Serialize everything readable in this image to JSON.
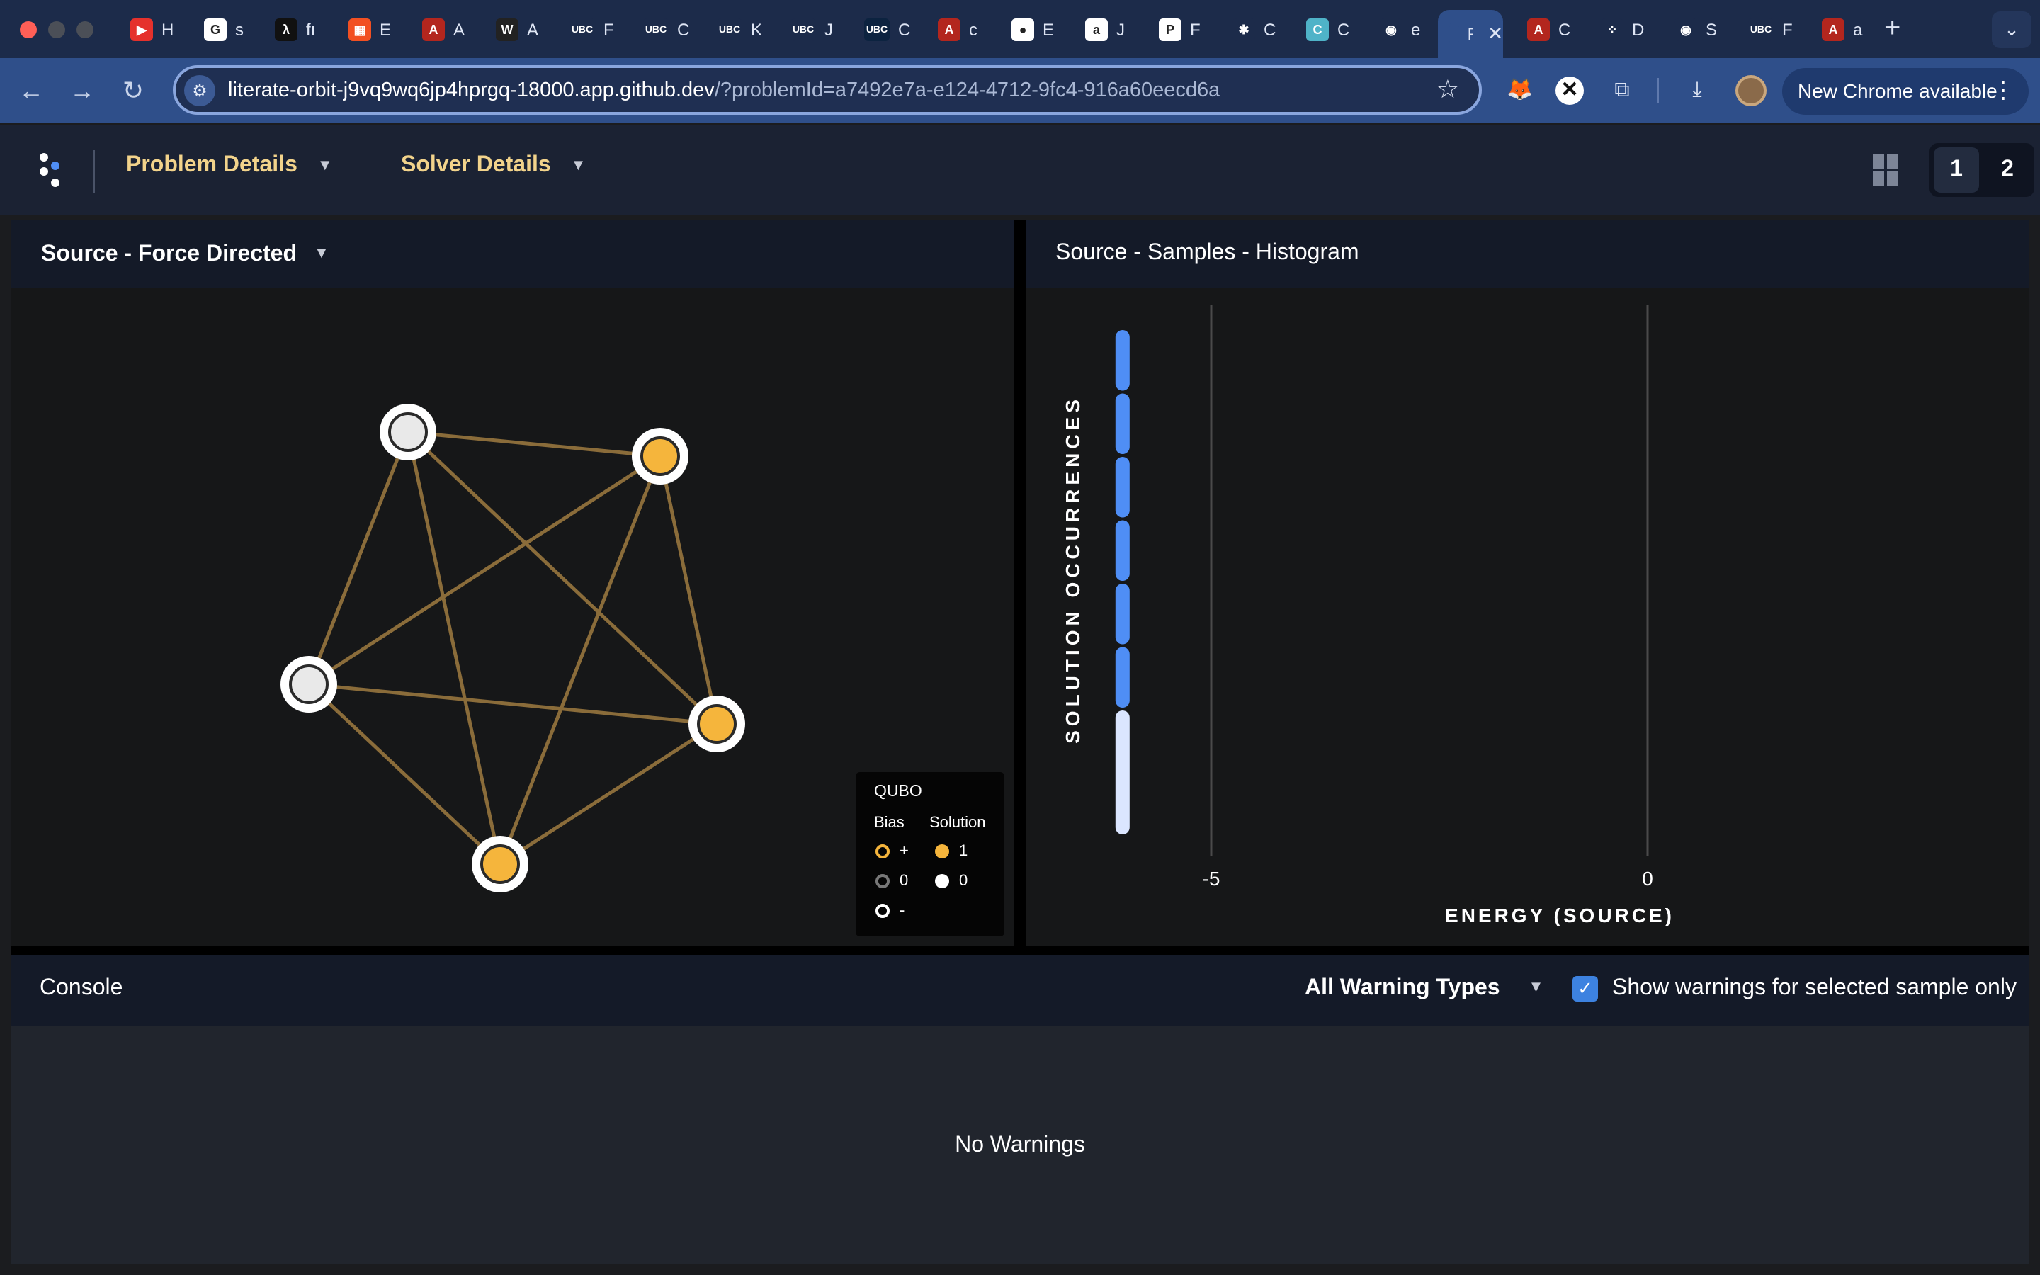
{
  "browser": {
    "tabs": [
      {
        "icon": "youtube-icon",
        "label": "H",
        "color": "#e5312c",
        "glyph": "▶"
      },
      {
        "icon": "google-icon",
        "label": "s",
        "color": "#ffffff",
        "glyph": "G"
      },
      {
        "icon": "lambda-icon",
        "label": "fı",
        "color": "#111111",
        "glyph": "λ"
      },
      {
        "icon": "microsoft-icon",
        "label": "E",
        "color": "#f25022",
        "glyph": "▦"
      },
      {
        "icon": "pdf-icon",
        "label": "A",
        "color": "#b3261e",
        "glyph": "A"
      },
      {
        "icon": "w-icon",
        "label": "A",
        "color": "#222222",
        "glyph": "W"
      },
      {
        "icon": "ubc-icon",
        "label": "F",
        "color": "#1c2b4a",
        "glyph": "UBC"
      },
      {
        "icon": "ubc-icon",
        "label": "C",
        "color": "#1c2b4a",
        "glyph": "UBC"
      },
      {
        "icon": "ubc-icon",
        "label": "K",
        "color": "#1c2b4a",
        "glyph": "UBC"
      },
      {
        "icon": "ubc-icon",
        "label": "J",
        "color": "#1c2b4a",
        "glyph": "UBC"
      },
      {
        "icon": "ubc-icon",
        "label": "C",
        "color": "#0c2340",
        "glyph": "UBC"
      },
      {
        "icon": "pdf-icon",
        "label": "c",
        "color": "#b3261e",
        "glyph": "A"
      },
      {
        "icon": "apple-icon",
        "label": "E",
        "color": "#ffffff",
        "glyph": "●"
      },
      {
        "icon": "amazon-icon",
        "label": "J",
        "color": "#ffffff",
        "glyph": "a"
      },
      {
        "icon": "p-icon",
        "label": "F",
        "color": "#ffffff",
        "glyph": "P"
      },
      {
        "icon": "openai-icon",
        "label": "C",
        "color": "#1c2b4a",
        "glyph": "✱"
      },
      {
        "icon": "c-icon",
        "label": "C",
        "color": "#4fb3c8",
        "glyph": "C"
      },
      {
        "icon": "github-icon",
        "label": "e",
        "color": "#1c2b4a",
        "glyph": "◉"
      },
      {
        "icon": "app-icon",
        "label": "F",
        "color": "#2f4f8a",
        "glyph": "",
        "active": true
      },
      {
        "icon": "pdf-icon",
        "label": "C",
        "color": "#b3261e",
        "glyph": "A"
      },
      {
        "icon": "dots-icon",
        "label": "D",
        "color": "#1c2b4a",
        "glyph": "⁘"
      },
      {
        "icon": "github-icon",
        "label": "S",
        "color": "#1c2b4a",
        "glyph": "◉"
      },
      {
        "icon": "ubc-icon",
        "label": "F",
        "color": "#1c2b4a",
        "glyph": "UBC"
      },
      {
        "icon": "pdf-icon",
        "label": "a",
        "color": "#b3261e",
        "glyph": "A"
      }
    ],
    "url_host": "literate-orbit-j9vq9wq6jp4hprgq-18000.app.github.dev",
    "url_rest": "/?problemId=a7492e7a-e124-4712-9fc4-916a60eecd6a",
    "update_label": "New Chrome available"
  },
  "header": {
    "problem_details": "Problem Details",
    "solver_details": "Solver Details",
    "pages": [
      "1",
      "2"
    ]
  },
  "left_panel": {
    "title": "Source - Force Directed",
    "legend": {
      "title": "QUBO",
      "bias_header": "Bias",
      "solution_header": "Solution",
      "bias_items": [
        "+",
        "0",
        "-"
      ],
      "solution_items": [
        "1",
        "0"
      ]
    },
    "graph": {
      "nodes": [
        {
          "id": "n1",
          "solution": 0
        },
        {
          "id": "n2",
          "solution": 1
        },
        {
          "id": "n3",
          "solution": 0
        },
        {
          "id": "n4",
          "solution": 1
        },
        {
          "id": "n5",
          "solution": 1
        }
      ],
      "edges": [
        [
          "n1",
          "n2"
        ],
        [
          "n1",
          "n3"
        ],
        [
          "n1",
          "n4"
        ],
        [
          "n1",
          "n5"
        ],
        [
          "n2",
          "n3"
        ],
        [
          "n2",
          "n4"
        ],
        [
          "n2",
          "n5"
        ],
        [
          "n3",
          "n4"
        ],
        [
          "n3",
          "n5"
        ],
        [
          "n4",
          "n5"
        ]
      ],
      "colors": {
        "edge": "#8a6c3a",
        "one": "#f5b53c",
        "zero": "#e9e9e9"
      }
    }
  },
  "right_panel": {
    "title": "Source - Samples - Histogram",
    "chart_data": {
      "type": "bar",
      "xlabel": "ENERGY (SOURCE)",
      "ylabel": "SOLUTION OCCURRENCES",
      "x_ticks": [
        -5,
        0
      ],
      "bars": [
        {
          "energy": -6
        }
      ],
      "bar_segments": 8,
      "colors": {
        "segment": "#4f8ef5",
        "selected": "#dbe6ff"
      }
    }
  },
  "console": {
    "title": "Console",
    "warning_filter": "All Warning Types",
    "checkbox_label": "Show warnings for selected sample only",
    "empty_text": "No Warnings"
  }
}
